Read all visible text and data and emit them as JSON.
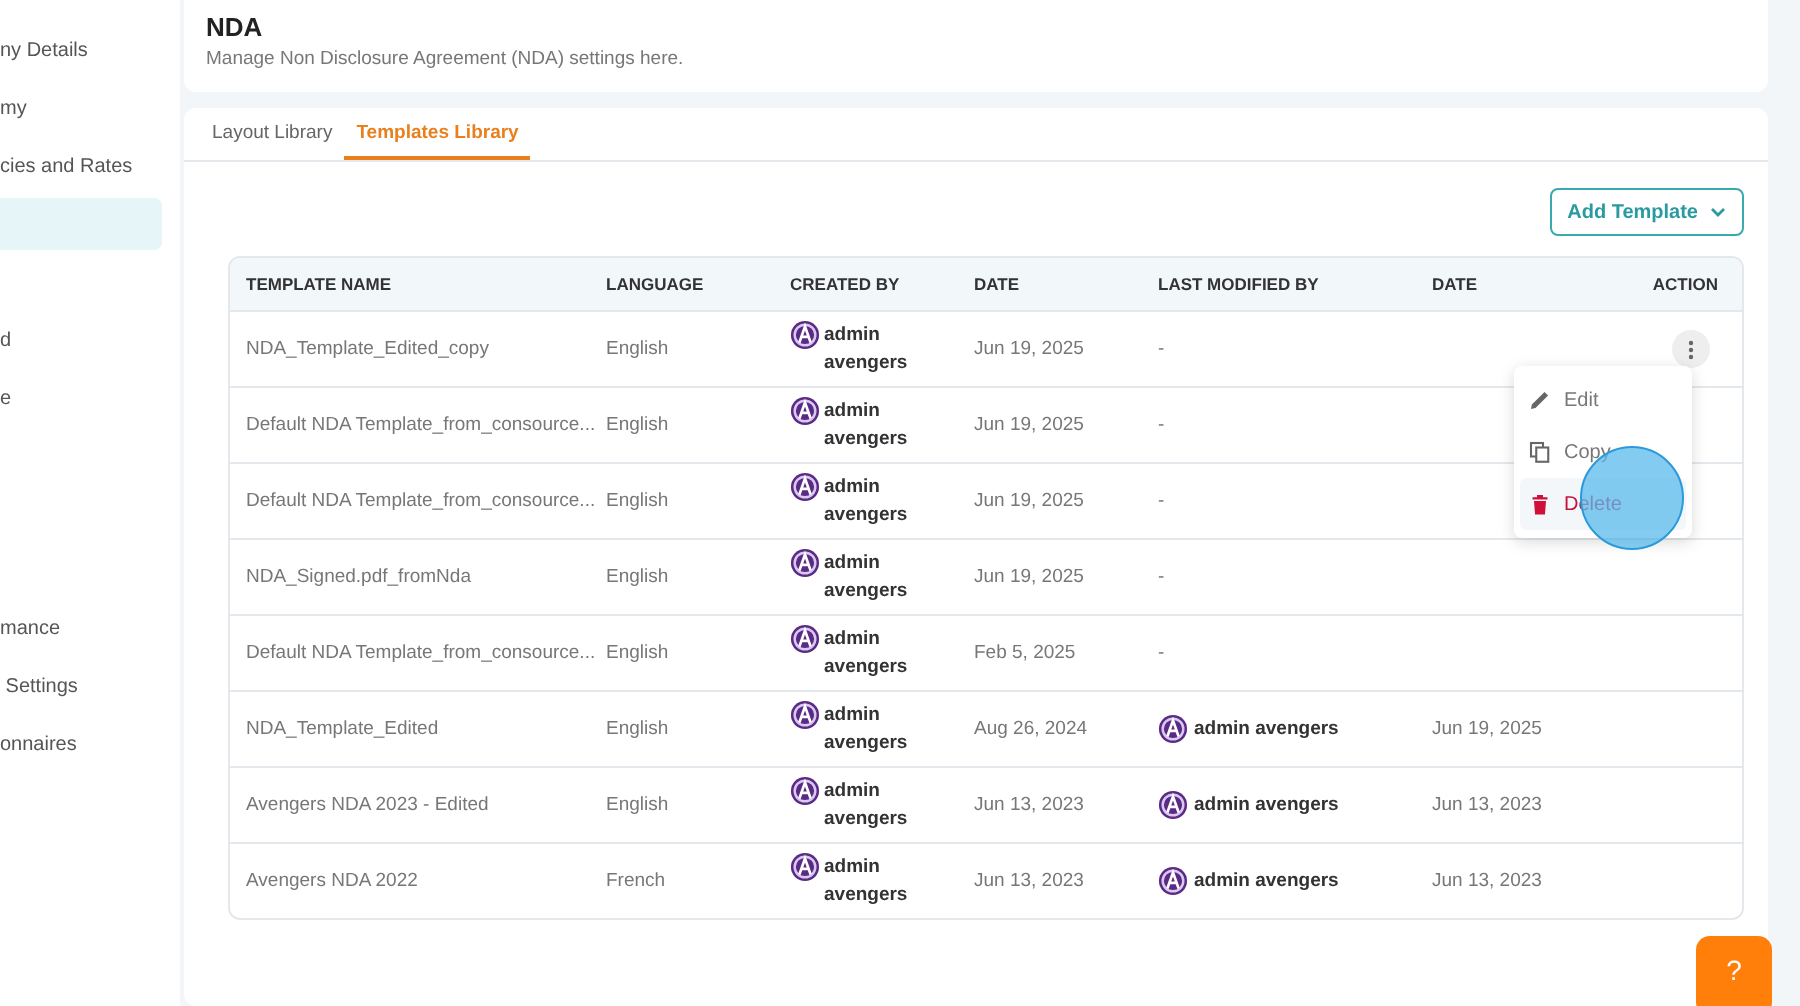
{
  "sidebar": {
    "sections": [
      {
        "items": [
          {
            "label": "ny Details",
            "selected": false
          },
          {
            "label": "my",
            "selected": false
          },
          {
            "label": "cies and Rates",
            "selected": false
          },
          {
            "selected": true
          }
        ]
      },
      {
        "items": [
          {
            "label": "d",
            "selected": false
          },
          {
            "label": "e",
            "selected": false
          }
        ]
      },
      {
        "items": [
          {
            "label": "mance",
            "selected": false
          },
          {
            "label": " Settings",
            "selected": false
          },
          {
            "label": "onnaires",
            "selected": false
          }
        ]
      }
    ]
  },
  "header": {
    "title": "NDA",
    "subtitle": "Manage Non Disclosure Agreement (NDA) settings here."
  },
  "tabs": [
    {
      "label": "Layout Library",
      "selected": false
    },
    {
      "label": "Templates Library",
      "selected": true
    }
  ],
  "add_button": {
    "label": "Add Template"
  },
  "table": {
    "columns": [
      "TEMPLATE NAME",
      "LANGUAGE",
      "CREATED BY",
      "DATE",
      "LAST MODIFIED BY",
      "DATE",
      "ACTION"
    ],
    "rows": [
      {
        "name": "NDA_Template_Edited_copy",
        "language": "English",
        "created_by": "admin avengers",
        "date": "Jun 19, 2025",
        "modified_by": "-",
        "hovered": true
      },
      {
        "name": "Default NDA Template_from_consource...",
        "language": "English",
        "created_by": "admin avengers",
        "date": "Jun 19, 2025",
        "modified_by": "-",
        "hovered": false
      },
      {
        "name": "Default NDA Template_from_consource...",
        "language": "English",
        "created_by": "admin avengers",
        "date": "Jun 19, 2025",
        "modified_by": "-",
        "hovered": false
      },
      {
        "name": "NDA_Signed.pdf_fromNda",
        "language": "English",
        "created_by": "admin avengers",
        "date": "Jun 19, 2025",
        "modified_by": "-",
        "hovered": false
      },
      {
        "name": "Default NDA Template_from_consource...",
        "language": "English",
        "created_by": "admin avengers",
        "date": "Feb 5, 2025",
        "modified_by": "-",
        "hovered": false
      },
      {
        "name": "NDA_Template_Edited",
        "language": "English",
        "created_by": "admin avengers",
        "date": "Aug 26, 2024",
        "modified_by": "admin avengers",
        "modified_date": "Jun 19, 2025",
        "hovered": false
      },
      {
        "name": "Avengers NDA 2023 - Edited",
        "language": "English",
        "created_by": "admin avengers",
        "date": "Jun 13, 2023",
        "modified_by": "admin avengers",
        "modified_date": "Jun 13, 2023",
        "hovered": false
      },
      {
        "name": "Avengers NDA 2022",
        "language": "French",
        "created_by": "admin avengers",
        "date": "Jun 13, 2023",
        "modified_by": "admin avengers",
        "modified_date": "Jun 13, 2023",
        "hovered": false
      }
    ]
  },
  "action_menu": {
    "items": [
      {
        "kind": "edit",
        "label": "Edit",
        "selected": false
      },
      {
        "kind": "copy",
        "label": "Copy",
        "selected": false
      },
      {
        "kind": "delete",
        "label": "Delete",
        "selected": true
      }
    ]
  },
  "help_button": {
    "icon": "?"
  }
}
